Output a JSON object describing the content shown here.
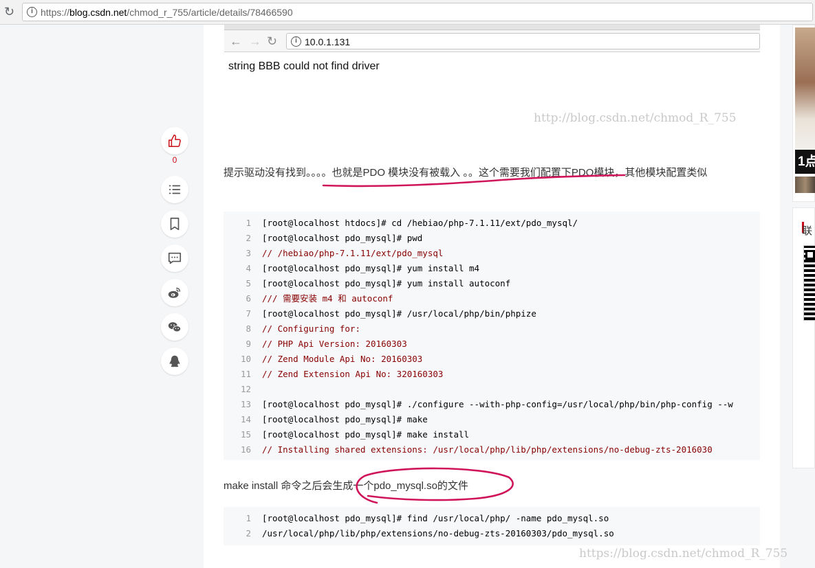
{
  "browser": {
    "url_scheme": "https://",
    "url_domain": "blog.csdn.net",
    "url_path": "/chmod_r_755/article/details/78466590"
  },
  "tools": {
    "like_count": "0",
    "icons": [
      "thumbs-up-icon",
      "list-icon",
      "bookmark-icon",
      "comment-icon",
      "weibo-icon",
      "wechat-icon",
      "qq-icon"
    ]
  },
  "embedded_screenshot": {
    "url": "10.0.1.131",
    "text": "string BBB could not find driver"
  },
  "watermarks": {
    "first": "http://blog.csdn.net/chmod_R_755",
    "second": "https://blog.csdn.net/chmod_R_755"
  },
  "paragraphs": {
    "p1": "提示驱动没有找到。。。。也就是PDO 模块没有被载入 。。这个需要我们配置下PDO模块，其他模块配置类似",
    "p2": "make install 命令之后会生成一个pdo_mysql.so的文件"
  },
  "code_block_1": [
    {
      "n": "1",
      "text": "[root@localhost htdocs]# cd /hebiao/php-7.1.11/ext/pdo_mysql/",
      "comment": false
    },
    {
      "n": "2",
      "text": "[root@localhost pdo_mysql]# pwd",
      "comment": false
    },
    {
      "n": "3",
      "text": "//   /hebiao/php-7.1.11/ext/pdo_mysql",
      "comment": true
    },
    {
      "n": "4",
      "text": "[root@localhost pdo_mysql]#  yum install m4",
      "comment": false
    },
    {
      "n": "5",
      "text": "[root@localhost pdo_mysql]#  yum install autoconf",
      "comment": false
    },
    {
      "n": "6",
      "text": "/// 需要安装 m4 和 autoconf",
      "comment": true
    },
    {
      "n": "7",
      "text": "[root@localhost pdo_mysql]#  /usr/local/php/bin/phpize",
      "comment": false
    },
    {
      "n": "8",
      "text": "// Configuring for:",
      "comment": true
    },
    {
      "n": "9",
      "text": "// PHP Api Version:         20160303",
      "comment": true
    },
    {
      "n": "10",
      "text": "// Zend Module Api No:      20160303",
      "comment": true
    },
    {
      "n": "11",
      "text": "// Zend Extension Api No:   320160303",
      "comment": true
    },
    {
      "n": "12",
      "text": "",
      "comment": false
    },
    {
      "n": "13",
      "text": "[root@localhost pdo_mysql]# ./configure  --with-php-config=/usr/local/php/bin/php-config --w",
      "comment": false
    },
    {
      "n": "14",
      "text": "[root@localhost pdo_mysql]# make",
      "comment": false
    },
    {
      "n": "15",
      "text": "[root@localhost pdo_mysql]# make install",
      "comment": false
    },
    {
      "n": "16",
      "text": "//  Installing shared extensions:     /usr/local/php/lib/php/extensions/no-debug-zts-2016030",
      "comment": true
    }
  ],
  "code_block_2": [
    {
      "n": "1",
      "text": "[root@localhost pdo_mysql]#  find /usr/local/php/ -name pdo_mysql.so",
      "comment": false
    },
    {
      "n": "2",
      "text": "/usr/local/php/lib/php/extensions/no-debug-zts-20160303/pdo_mysql.so",
      "comment": false
    }
  ],
  "sidebar": {
    "ad_band_text": "1点",
    "contact_title": "联"
  },
  "colors": {
    "accent": "#ca0c16",
    "annotation": "#d0145a"
  }
}
